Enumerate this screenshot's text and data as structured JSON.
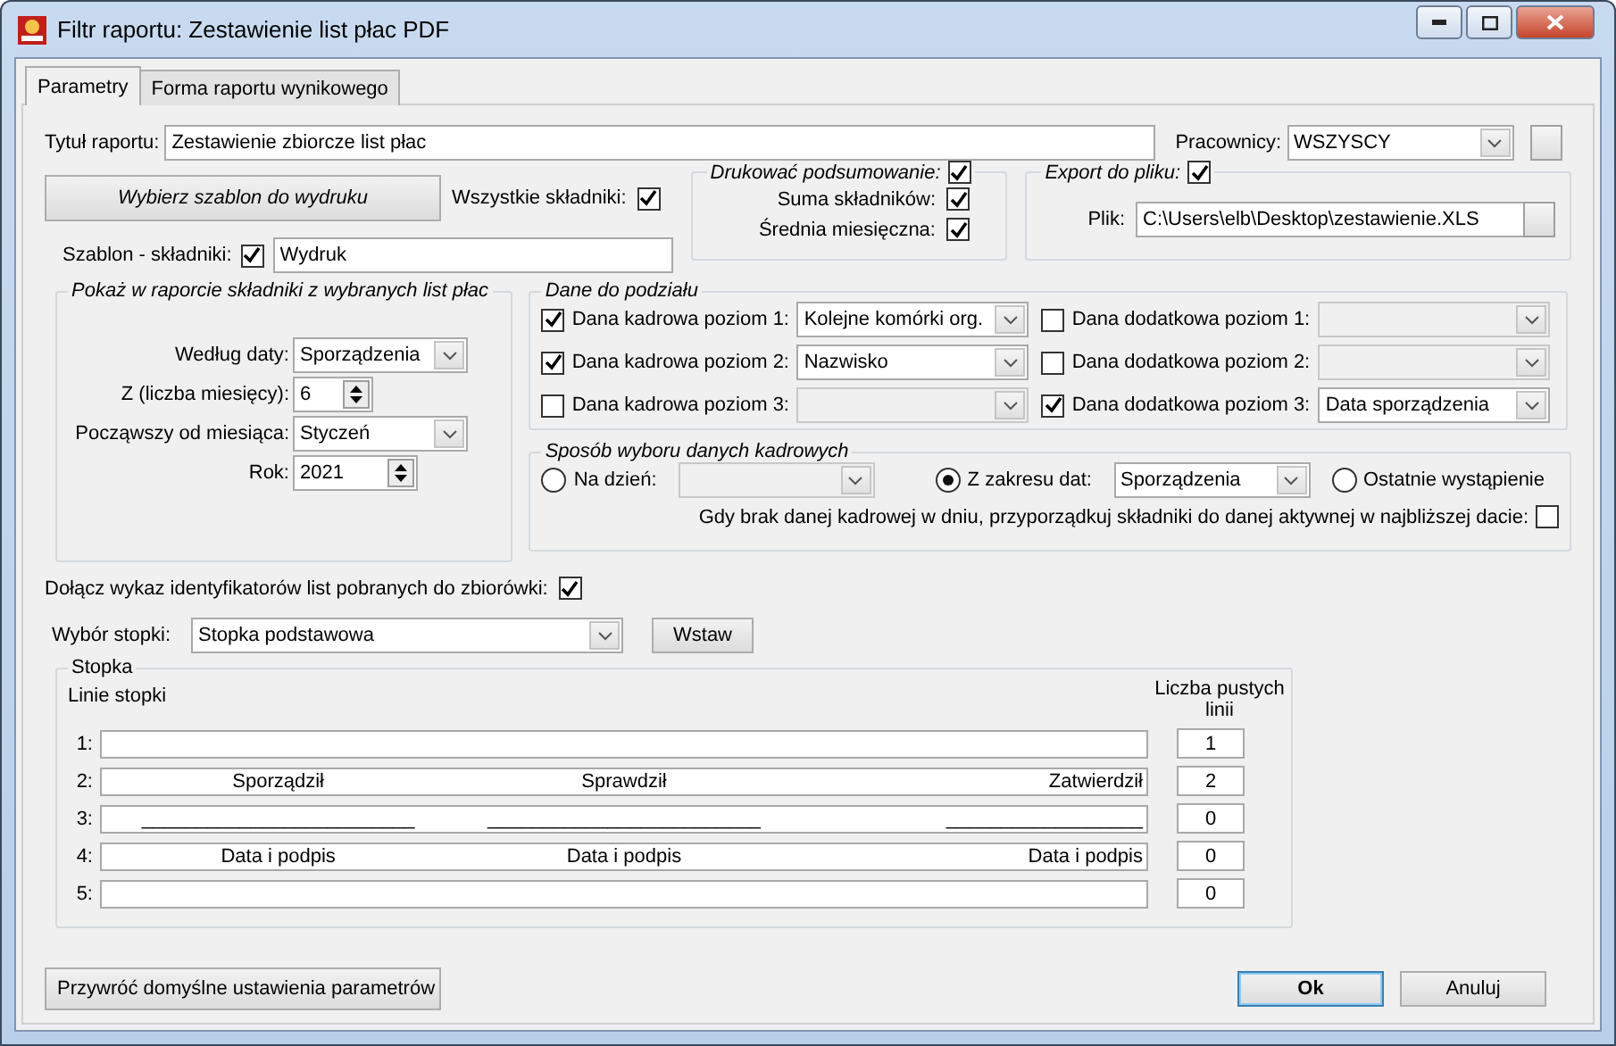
{
  "window": {
    "title": "Filtr raportu: Zestawienie list płac PDF"
  },
  "tabs": [
    {
      "label": "Parametry",
      "selected": true
    },
    {
      "label": "Forma raportu wynikowego",
      "selected": false
    }
  ],
  "report_title": {
    "label": "Tytuł raportu:",
    "value": "Zestawienie zbiorcze list płac"
  },
  "employees": {
    "label": "Pracownicy:",
    "value": "WSZYSCY"
  },
  "template_button": "Wybierz szablon do wydruku",
  "all_components": {
    "label": "Wszystkie składniki:",
    "checked": true
  },
  "template_components": {
    "label": "Szablon - składniki:",
    "checked": true,
    "value": "Wydruk"
  },
  "print_summary": {
    "title": "Drukować podsumowanie:",
    "checked": true,
    "items": [
      {
        "label": "Suma składników:",
        "checked": true
      },
      {
        "label": "Średnia miesięczna:",
        "checked": true
      }
    ]
  },
  "export": {
    "title": "Export do pliku:",
    "checked": true,
    "file_label": "Plik:",
    "file_value": "C:\\Users\\elb\\Desktop\\zestawienie.XLS"
  },
  "show_components": {
    "title": "Pokaż w raporcie składniki z wybranych list płac",
    "fields": [
      {
        "kind": "select",
        "label": "Według daty:",
        "value": "Sporządzenia"
      },
      {
        "kind": "spin",
        "label": "Z (liczba miesięcy):",
        "value": "6"
      },
      {
        "kind": "select",
        "label": "Począwszy od miesiąca:",
        "value": "Styczeń"
      },
      {
        "kind": "spin",
        "label": "Rok:",
        "value": "2021"
      }
    ]
  },
  "split_data": {
    "title": "Dane do podziału",
    "personnel": [
      {
        "label": "Dana kadrowa poziom 1:",
        "checked": true,
        "value": "Kolejne komórki org.",
        "disabled": false
      },
      {
        "label": "Dana kadrowa poziom 2:",
        "checked": true,
        "value": "Nazwisko",
        "disabled": false
      },
      {
        "label": "Dana kadrowa poziom 3:",
        "checked": false,
        "disabled": true
      }
    ],
    "additional": [
      {
        "label": "Dana dodatkowa poziom 1:",
        "checked": false,
        "disabled": true
      },
      {
        "label": "Dana dodatkowa poziom 2:",
        "checked": false,
        "disabled": true
      },
      {
        "label": "Dana dodatkowa poziom 3:",
        "checked": true,
        "value": "Data sporządzenia",
        "disabled": false
      }
    ]
  },
  "selection_method": {
    "title": "Sposób wyboru danych kadrowych",
    "options": [
      {
        "label": "Na dzień:",
        "selected": false,
        "kind": "select",
        "disabled": true
      },
      {
        "label": "Z zakresu dat:",
        "selected": true,
        "kind": "select",
        "value": "Sporządzenia",
        "disabled": false
      },
      {
        "label": "Ostatnie wystąpienie",
        "selected": false,
        "kind": "plain"
      }
    ],
    "fallback": {
      "label": "Gdy brak danej kadrowej w dniu, przyporządkuj składniki do danej aktywnej w najbliższej dacie:",
      "checked": false
    }
  },
  "attach_ids": {
    "label": "Dołącz wykaz identyfikatorów list pobranych do zbiorówki:",
    "checked": true
  },
  "footer_choice": {
    "label": "Wybór stopki:",
    "value": "Stopka podstawowa",
    "insert_button": "Wstaw"
  },
  "footer": {
    "title": "Stopka",
    "lines_header": "Linie stopki",
    "blank_header": "Liczba pustych linii",
    "lines": [
      {
        "number": "1:",
        "blank": "1"
      },
      {
        "number": "2:",
        "left": "Sporządził",
        "center": "Sprawdził",
        "right": "Zatwierdził",
        "blank": "2"
      },
      {
        "number": "3:",
        "left": "_________________________",
        "center": "_________________________",
        "right": "__________________",
        "blank": "0"
      },
      {
        "number": "4:",
        "left": "Data i podpis",
        "center": "Data i podpis",
        "right": "Data i podpis",
        "blank": "0"
      },
      {
        "number": "5:",
        "blank": "0"
      }
    ]
  },
  "buttons": {
    "restore": "Przywróć domyślne ustawienia parametrów",
    "ok": "Ok",
    "cancel": "Anuluj"
  }
}
